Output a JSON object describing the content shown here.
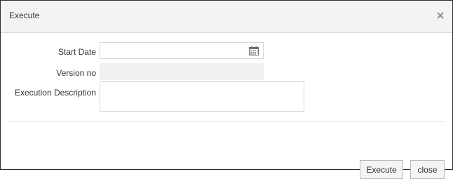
{
  "dialog": {
    "title": "Execute",
    "close_icon": "close-icon"
  },
  "form": {
    "start_date": {
      "label": "Start Date",
      "value": "",
      "icon": "calendar-icon"
    },
    "version_no": {
      "label": "Version no",
      "value": ""
    },
    "execution_description": {
      "label": "Execution Description",
      "value": ""
    }
  },
  "footer": {
    "execute_label": "Execute",
    "close_label": "close"
  },
  "colors": {
    "header_bg": "#f3f3f3",
    "readonly_bg": "#f1f1f1",
    "button_bg": "#f4f4f4",
    "border": "#2b2b2b"
  }
}
